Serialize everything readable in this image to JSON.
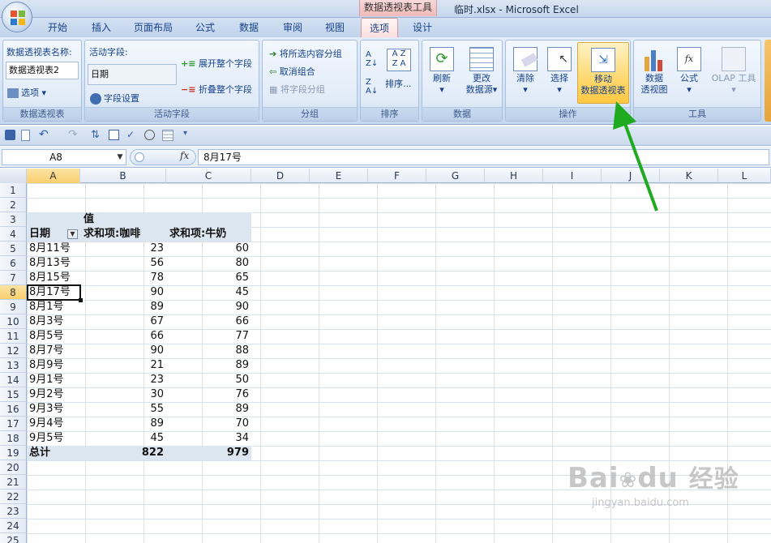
{
  "window": {
    "title": "临时.xlsx - Microsoft Excel",
    "context_tab_label": "数据透视表工具"
  },
  "tabs": [
    {
      "label": "开始"
    },
    {
      "label": "插入"
    },
    {
      "label": "页面布局"
    },
    {
      "label": "公式"
    },
    {
      "label": "数据"
    },
    {
      "label": "审阅"
    },
    {
      "label": "视图"
    },
    {
      "label": "选项"
    },
    {
      "label": "设计"
    }
  ],
  "ribbon": {
    "pivot_group": {
      "label": "数据透视表",
      "name_caption": "数据透视表名称:",
      "name_value": "数据透视表2",
      "options_label": "选项"
    },
    "field_group": {
      "label": "活动字段",
      "caption": "活动字段:",
      "value": "日期",
      "settings_label": "字段设置",
      "expand_label": "展开整个字段",
      "collapse_label": "折叠整个字段"
    },
    "group_group": {
      "label": "分组",
      "group_selection": "将所选内容分组",
      "ungroup": "取消组合",
      "group_field": "将字段分组"
    },
    "sort_group": {
      "label": "排序",
      "sort_label": "排序..."
    },
    "data_group": {
      "label": "数据",
      "refresh_label": "刷新",
      "change_source_line1": "更改",
      "change_source_line2": "数据源"
    },
    "actions_group": {
      "label": "操作",
      "clear_label": "清除",
      "select_label": "选择",
      "move_line1": "移动",
      "move_line2": "数据透视表"
    },
    "tools_group": {
      "label": "工具",
      "chart_line1": "数据",
      "chart_line2": "透视图",
      "formula_label": "公式",
      "olap_label": "OLAP 工具"
    }
  },
  "formula_bar": {
    "name_box": "A8",
    "fx": "fx",
    "formula": "8月17号"
  },
  "columns": [
    "A",
    "B",
    "C",
    "D",
    "E",
    "F",
    "G",
    "H",
    "I",
    "J",
    "K",
    "L"
  ],
  "rows": [
    "1",
    "2",
    "3",
    "4",
    "5",
    "6",
    "7",
    "8",
    "9",
    "10",
    "11",
    "12",
    "13",
    "14",
    "15",
    "16",
    "17",
    "18",
    "19",
    "20",
    "21",
    "22",
    "23",
    "24",
    "25"
  ],
  "selected_cell": {
    "col": "A",
    "row": "8"
  },
  "pivot": {
    "value_caption": "值",
    "row_header": "日期",
    "col_coffee": "求和项:咖啡",
    "col_milk": "求和项:牛奶",
    "rows": [
      {
        "date": "8月11号",
        "coffee": "23",
        "milk": "60"
      },
      {
        "date": "8月13号",
        "coffee": "56",
        "milk": "80"
      },
      {
        "date": "8月15号",
        "coffee": "78",
        "milk": "65"
      },
      {
        "date": "8月17号",
        "coffee": "90",
        "milk": "45"
      },
      {
        "date": "8月1号",
        "coffee": "89",
        "milk": "90"
      },
      {
        "date": "8月3号",
        "coffee": "67",
        "milk": "66"
      },
      {
        "date": "8月5号",
        "coffee": "66",
        "milk": "77"
      },
      {
        "date": "8月7号",
        "coffee": "90",
        "milk": "88"
      },
      {
        "date": "8月9号",
        "coffee": "21",
        "milk": "89"
      },
      {
        "date": "9月1号",
        "coffee": "23",
        "milk": "50"
      },
      {
        "date": "9月2号",
        "coffee": "30",
        "milk": "76"
      },
      {
        "date": "9月3号",
        "coffee": "55",
        "milk": "89"
      },
      {
        "date": "9月4号",
        "coffee": "89",
        "milk": "70"
      },
      {
        "date": "9月5号",
        "coffee": "45",
        "milk": "34"
      }
    ],
    "total_label": "总计",
    "total_coffee": "822",
    "total_milk": "979"
  },
  "watermark": {
    "brand": "Bai",
    "brand2": "du",
    "brand_cn": "经验",
    "url": "jingyan.baidu.com"
  },
  "colors": {
    "accent": "#15428b",
    "highlight": "#ffd86f",
    "arrow": "#1faa1f",
    "pivot_band": "#dce6f1"
  }
}
